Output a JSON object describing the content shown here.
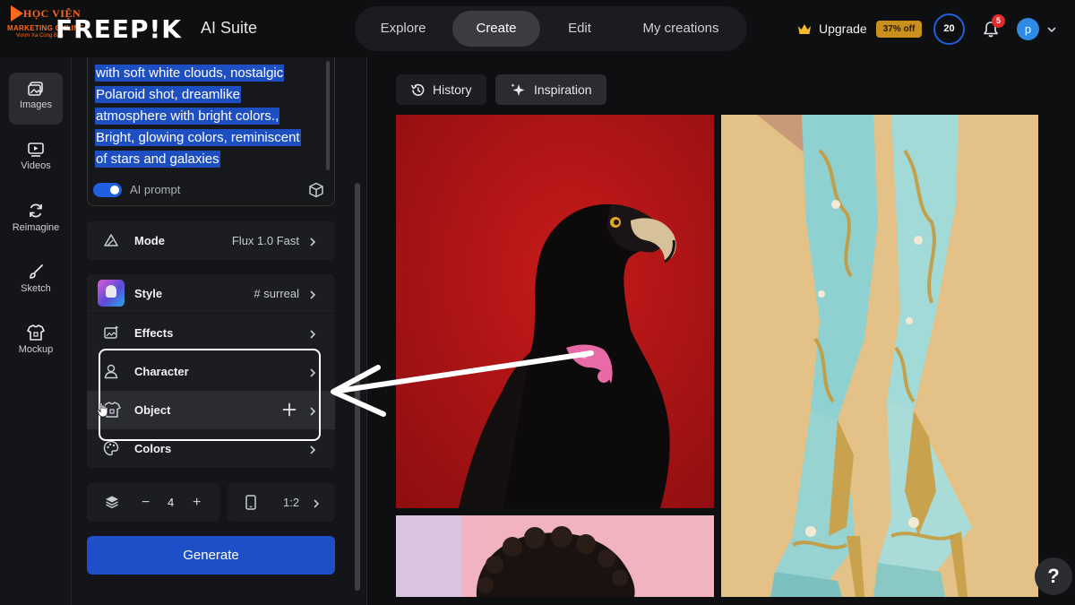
{
  "watermark": {
    "line1": "HỌC VIỆN",
    "line2": "MARKETING ONLINE",
    "line3": "Vươn Xa Cùng Bạn"
  },
  "header": {
    "brand": "FREEP!K",
    "suite": "AI Suite",
    "nav": [
      {
        "label": "Explore"
      },
      {
        "label": "Create"
      },
      {
        "label": "Edit"
      },
      {
        "label": "My creations"
      }
    ],
    "active_nav": "Create",
    "upgrade_label": "Upgrade",
    "discount": "37% off",
    "credits": "20",
    "notifications": "5",
    "avatar_initial": "p"
  },
  "rail": {
    "items": [
      {
        "label": "Images",
        "icon": "image-icon"
      },
      {
        "label": "Videos",
        "icon": "video-icon"
      },
      {
        "label": "Reimagine",
        "icon": "refresh-icon"
      },
      {
        "label": "Sketch",
        "icon": "brush-icon"
      },
      {
        "label": "Mockup",
        "icon": "shirt-icon"
      }
    ],
    "active": "Images"
  },
  "prompt": {
    "lines": [
      "with soft white clouds, nostalgic",
      "Polaroid shot, dreamlike",
      "atmosphere with bright colors.,",
      "Bright, glowing colors, reminiscent",
      "of stars and galaxies"
    ],
    "ai_prompt_label": "AI prompt",
    "ai_prompt_enabled": true
  },
  "settings": {
    "mode": {
      "label": "Mode",
      "value": "Flux 1.0 Fast"
    },
    "style": {
      "label": "Style",
      "value": "# surreal"
    },
    "effects": {
      "label": "Effects"
    },
    "character": {
      "label": "Character"
    },
    "object": {
      "label": "Object"
    },
    "colors": {
      "label": "Colors"
    }
  },
  "quantity": {
    "value": "4",
    "minus": "−",
    "plus": "+"
  },
  "aspect_ratio": {
    "value": "1:2"
  },
  "generate_label": "Generate",
  "main": {
    "history_label": "History",
    "inspiration_label": "Inspiration"
  },
  "help_label": "?",
  "colors": {
    "accent_blue": "#1f4fc8",
    "selection": "#1e4fc2",
    "discount": "#c9901d",
    "notification": "#e22b2b"
  }
}
